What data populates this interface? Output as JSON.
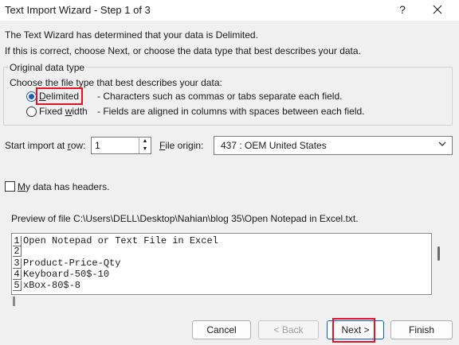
{
  "window": {
    "title": "Text Import Wizard - Step 1 of 3",
    "help_label": "?",
    "close_label": "✕"
  },
  "intro": {
    "line1": "The Text Wizard has determined that your data is Delimited.",
    "line2": "If this is correct, choose Next, or choose the data type that best describes your data."
  },
  "original_data_type": {
    "group_label": "Original data type",
    "prompt": "Choose the file type that best describes your data:",
    "options": [
      {
        "label": "Delimited",
        "description": "- Characters such as commas or tabs separate each field.",
        "checked": true
      },
      {
        "label": "Fixed width",
        "description": "- Fields are aligned in columns with spaces between each field.",
        "checked": false
      }
    ]
  },
  "start_import": {
    "label": "Start import at row:",
    "value": "1"
  },
  "file_origin": {
    "label": "File origin:",
    "value": "437 : OEM United States"
  },
  "headers_checkbox": {
    "label": "My data has headers.",
    "checked": false
  },
  "preview": {
    "label": "Preview of file C:\\Users\\DELL\\Desktop\\Nahian\\blog 35\\Open Notepad in Excel.txt.",
    "rows": [
      {
        "num": "1",
        "text": "Open Notepad or Text File in Excel"
      },
      {
        "num": "2",
        "text": ""
      },
      {
        "num": "3",
        "text": "Product-Price-Qty"
      },
      {
        "num": "4",
        "text": "Keyboard-50$-10"
      },
      {
        "num": "5",
        "text": "xBox-80$-8"
      }
    ]
  },
  "buttons": {
    "cancel": "Cancel",
    "back": "< Back",
    "next": "Next >",
    "finish": "Finish"
  },
  "colors": {
    "highlight": "#e81123",
    "accent": "#0067c0"
  },
  "icons": {
    "close": "close-icon",
    "help": "help-icon",
    "dropdown": "chevron-down-icon"
  }
}
